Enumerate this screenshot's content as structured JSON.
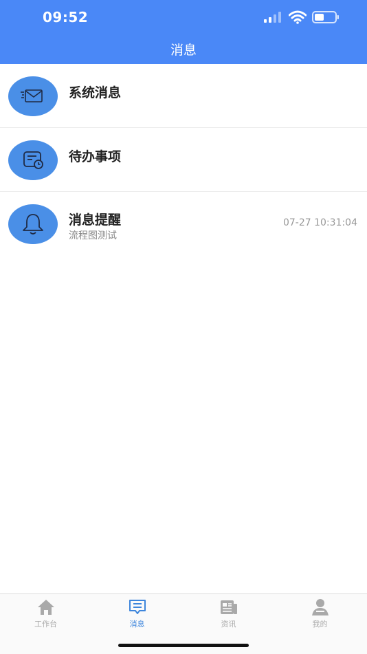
{
  "status_bar": {
    "time": "09:52"
  },
  "nav": {
    "title": "消息"
  },
  "messages": [
    {
      "title": "系统消息",
      "subtitle": "",
      "time": "",
      "icon": "mail-icon"
    },
    {
      "title": "待办事项",
      "subtitle": "",
      "time": "",
      "icon": "todo-clock-icon"
    },
    {
      "title": "消息提醒",
      "subtitle": "流程图测试",
      "time": "07-27 10:31:04",
      "icon": "bell-icon"
    }
  ],
  "tabbar": {
    "tabs": [
      {
        "label": "工作台",
        "icon": "home-icon",
        "active": false
      },
      {
        "label": "消息",
        "icon": "message-icon",
        "active": true
      },
      {
        "label": "资讯",
        "icon": "news-icon",
        "active": false
      },
      {
        "label": "我的",
        "icon": "user-icon",
        "active": false
      }
    ]
  },
  "colors": {
    "header": "#4a88f7",
    "avatar": "#4a8fe7",
    "active_tab": "#3e86dc"
  }
}
